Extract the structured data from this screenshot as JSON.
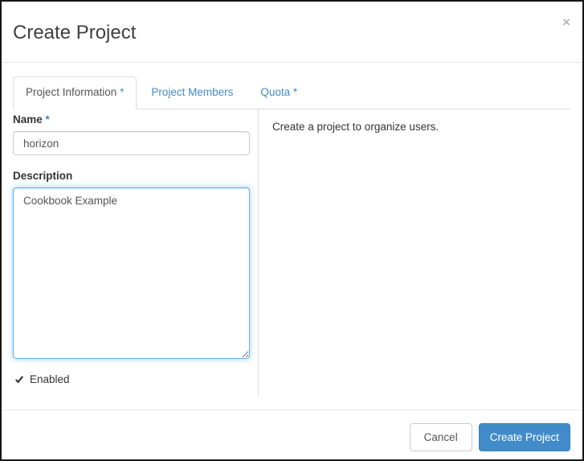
{
  "modal": {
    "title": "Create Project",
    "close_icon": "×"
  },
  "tabs": [
    {
      "label": "Project Information",
      "mark": "*",
      "active": true
    },
    {
      "label": "Project Members",
      "mark": "",
      "active": false
    },
    {
      "label": "Quota",
      "mark": "*",
      "active": false
    }
  ],
  "form": {
    "name_label": "Name",
    "name_required_mark": "*",
    "name_value": "horizon",
    "description_label": "Description",
    "description_value": "Cookbook Example",
    "enabled_label": "Enabled",
    "enabled_checked": true
  },
  "help": {
    "text": "Create a project to organize users."
  },
  "footer": {
    "cancel_label": "Cancel",
    "submit_label": "Create Project"
  },
  "colors": {
    "accent": "#428bca",
    "accent_border": "#357ebd",
    "focus_border": "#66afe9",
    "tab_link": "#428bca",
    "divider": "#ddd",
    "header_divider": "#e5e5e5",
    "title_text": "#404040",
    "body_text": "#333333",
    "input_text": "#555555"
  }
}
